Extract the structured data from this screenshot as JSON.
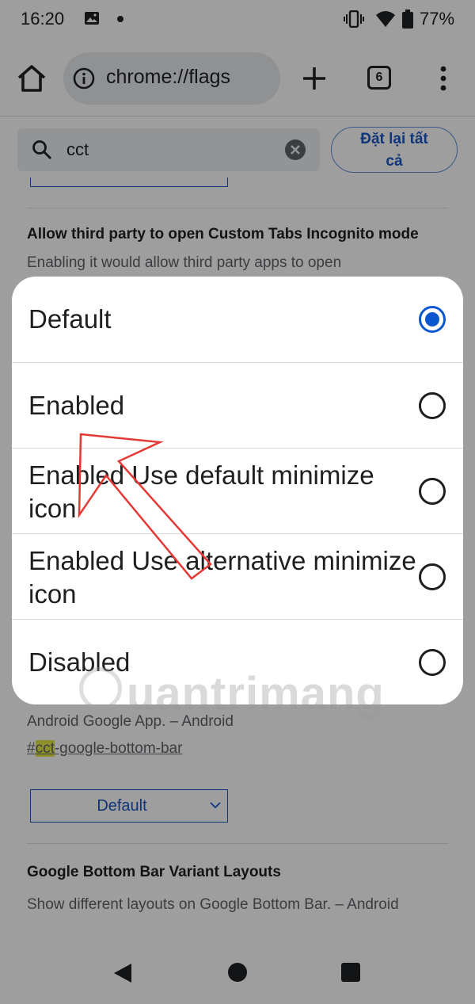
{
  "status_bar": {
    "time": "16:20",
    "battery_percent": "77%"
  },
  "toolbar": {
    "url": "chrome://flags",
    "tab_count": "6"
  },
  "search": {
    "value": "cct",
    "reset_label_line1": "Đặt lại tất",
    "reset_label_line2": "cả"
  },
  "flags": [
    {
      "title": "Allow third party to open Custom Tabs Incognito mode",
      "description": "Enabling it would allow third party apps to open"
    },
    {
      "description": "Android Google App. – Android",
      "link_highlight": "cct",
      "link_rest": "-google-bottom-bar",
      "link_prefix": "#",
      "dropdown_value": "Default"
    },
    {
      "title": "Google Bottom Bar Variant Layouts",
      "description": "Show different layouts on Google Bottom Bar. – Android"
    }
  ],
  "dialog": {
    "options": [
      {
        "label": "Default",
        "selected": true
      },
      {
        "label": "Enabled",
        "selected": false
      },
      {
        "label": "Enabled Use default minimize icon",
        "selected": false
      },
      {
        "label": "Enabled Use alternative minimize icon",
        "selected": false
      },
      {
        "label": "Disabled",
        "selected": false
      }
    ]
  },
  "watermark": "uantrimang",
  "colors": {
    "accent": "#0b57d0",
    "link_blue": "#1a56c4",
    "annotation_red": "#e53935",
    "highlight": "#e6e94a"
  }
}
